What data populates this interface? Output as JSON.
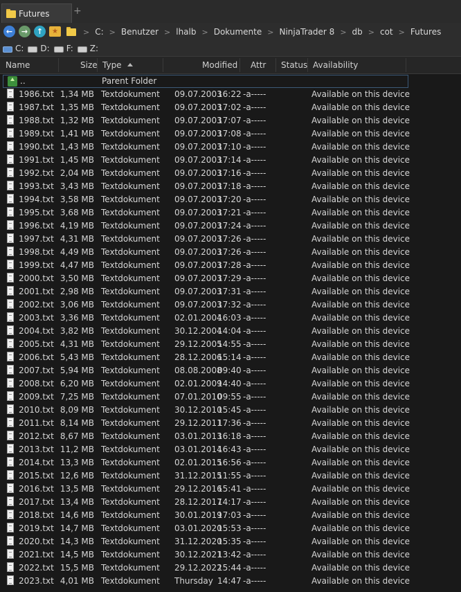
{
  "tab": {
    "title": "Futures",
    "add_label": "+"
  },
  "toolbar": {
    "breadcrumbs": [
      "C:",
      "Benutzer",
      "lhalb",
      "Dokumente",
      "NinjaTrader 8",
      "db",
      "cot",
      "Futures"
    ],
    "separator": ">"
  },
  "drives": [
    {
      "label": "C:",
      "icon": "system-drive-icon"
    },
    {
      "label": "D:",
      "icon": "drive-icon"
    },
    {
      "label": "F:",
      "icon": "drive-icon"
    },
    {
      "label": "Z:",
      "icon": "drive-icon"
    }
  ],
  "columns": {
    "name": "Name",
    "size": "Size",
    "type": "Type",
    "modified": "Modified",
    "attr": "Attr",
    "status": "Status",
    "availability": "Availability"
  },
  "parent": {
    "name": "..",
    "type": "Parent Folder"
  },
  "files": [
    {
      "name": "1986.txt",
      "size": "1,34 MB",
      "type": "Textdokument",
      "date": "09.07.2003",
      "time": "16:22",
      "attr": "-a-----",
      "availability": "Available on this device"
    },
    {
      "name": "1987.txt",
      "size": "1,35 MB",
      "type": "Textdokument",
      "date": "09.07.2003",
      "time": "17:02",
      "attr": "-a-----",
      "availability": "Available on this device"
    },
    {
      "name": "1988.txt",
      "size": "1,32 MB",
      "type": "Textdokument",
      "date": "09.07.2003",
      "time": "17:07",
      "attr": "-a-----",
      "availability": "Available on this device"
    },
    {
      "name": "1989.txt",
      "size": "1,41 MB",
      "type": "Textdokument",
      "date": "09.07.2003",
      "time": "17:08",
      "attr": "-a-----",
      "availability": "Available on this device"
    },
    {
      "name": "1990.txt",
      "size": "1,43 MB",
      "type": "Textdokument",
      "date": "09.07.2003",
      "time": "17:10",
      "attr": "-a-----",
      "availability": "Available on this device"
    },
    {
      "name": "1991.txt",
      "size": "1,45 MB",
      "type": "Textdokument",
      "date": "09.07.2003",
      "time": "17:14",
      "attr": "-a-----",
      "availability": "Available on this device"
    },
    {
      "name": "1992.txt",
      "size": "2,04 MB",
      "type": "Textdokument",
      "date": "09.07.2003",
      "time": "17:16",
      "attr": "-a-----",
      "availability": "Available on this device"
    },
    {
      "name": "1993.txt",
      "size": "3,43 MB",
      "type": "Textdokument",
      "date": "09.07.2003",
      "time": "17:18",
      "attr": "-a-----",
      "availability": "Available on this device"
    },
    {
      "name": "1994.txt",
      "size": "3,58 MB",
      "type": "Textdokument",
      "date": "09.07.2003",
      "time": "17:20",
      "attr": "-a-----",
      "availability": "Available on this device"
    },
    {
      "name": "1995.txt",
      "size": "3,68 MB",
      "type": "Textdokument",
      "date": "09.07.2003",
      "time": "17:21",
      "attr": "-a-----",
      "availability": "Available on this device"
    },
    {
      "name": "1996.txt",
      "size": "4,19 MB",
      "type": "Textdokument",
      "date": "09.07.2003",
      "time": "17:24",
      "attr": "-a-----",
      "availability": "Available on this device"
    },
    {
      "name": "1997.txt",
      "size": "4,31 MB",
      "type": "Textdokument",
      "date": "09.07.2003",
      "time": "17:26",
      "attr": "-a-----",
      "availability": "Available on this device"
    },
    {
      "name": "1998.txt",
      "size": "4,49 MB",
      "type": "Textdokument",
      "date": "09.07.2003",
      "time": "17:26",
      "attr": "-a-----",
      "availability": "Available on this device"
    },
    {
      "name": "1999.txt",
      "size": "4,47 MB",
      "type": "Textdokument",
      "date": "09.07.2003",
      "time": "17:28",
      "attr": "-a-----",
      "availability": "Available on this device"
    },
    {
      "name": "2000.txt",
      "size": "3,50 MB",
      "type": "Textdokument",
      "date": "09.07.2003",
      "time": "17:29",
      "attr": "-a-----",
      "availability": "Available on this device"
    },
    {
      "name": "2001.txt",
      "size": "2,98 MB",
      "type": "Textdokument",
      "date": "09.07.2003",
      "time": "17:31",
      "attr": "-a-----",
      "availability": "Available on this device"
    },
    {
      "name": "2002.txt",
      "size": "3,06 MB",
      "type": "Textdokument",
      "date": "09.07.2003",
      "time": "17:32",
      "attr": "-a-----",
      "availability": "Available on this device"
    },
    {
      "name": "2003.txt",
      "size": "3,36 MB",
      "type": "Textdokument",
      "date": "02.01.2004",
      "time": "16:03",
      "attr": "-a-----",
      "availability": "Available on this device"
    },
    {
      "name": "2004.txt",
      "size": "3,82 MB",
      "type": "Textdokument",
      "date": "30.12.2004",
      "time": "14:04",
      "attr": "-a-----",
      "availability": "Available on this device"
    },
    {
      "name": "2005.txt",
      "size": "4,31 MB",
      "type": "Textdokument",
      "date": "29.12.2005",
      "time": "14:55",
      "attr": "-a-----",
      "availability": "Available on this device"
    },
    {
      "name": "2006.txt",
      "size": "5,43 MB",
      "type": "Textdokument",
      "date": "28.12.2006",
      "time": "15:14",
      "attr": "-a-----",
      "availability": "Available on this device"
    },
    {
      "name": "2007.txt",
      "size": "5,94 MB",
      "type": "Textdokument",
      "date": "08.08.2008",
      "time": "09:40",
      "attr": "-a-----",
      "availability": "Available on this device"
    },
    {
      "name": "2008.txt",
      "size": "6,20 MB",
      "type": "Textdokument",
      "date": "02.01.2009",
      "time": "14:40",
      "attr": "-a-----",
      "availability": "Available on this device"
    },
    {
      "name": "2009.txt",
      "size": "7,25 MB",
      "type": "Textdokument",
      "date": "07.01.2010",
      "time": "09:55",
      "attr": "-a-----",
      "availability": "Available on this device"
    },
    {
      "name": "2010.txt",
      "size": "8,09 MB",
      "type": "Textdokument",
      "date": "30.12.2010",
      "time": "15:45",
      "attr": "-a-----",
      "availability": "Available on this device"
    },
    {
      "name": "2011.txt",
      "size": "8,14 MB",
      "type": "Textdokument",
      "date": "29.12.2011",
      "time": "17:36",
      "attr": "-a-----",
      "availability": "Available on this device"
    },
    {
      "name": "2012.txt",
      "size": "8,67 MB",
      "type": "Textdokument",
      "date": "03.01.2013",
      "time": "16:18",
      "attr": "-a-----",
      "availability": "Available on this device"
    },
    {
      "name": "2013.txt",
      "size": "11,2 MB",
      "type": "Textdokument",
      "date": "03.01.2014",
      "time": "16:43",
      "attr": "-a-----",
      "availability": "Available on this device"
    },
    {
      "name": "2014.txt",
      "size": "13,3 MB",
      "type": "Textdokument",
      "date": "02.01.2015",
      "time": "16:56",
      "attr": "-a-----",
      "availability": "Available on this device"
    },
    {
      "name": "2015.txt",
      "size": "12,6 MB",
      "type": "Textdokument",
      "date": "31.12.2015",
      "time": "11:55",
      "attr": "-a-----",
      "availability": "Available on this device"
    },
    {
      "name": "2016.txt",
      "size": "13,5 MB",
      "type": "Textdokument",
      "date": "29.12.2016",
      "time": "15:41",
      "attr": "-a-----",
      "availability": "Available on this device"
    },
    {
      "name": "2017.txt",
      "size": "13,4 MB",
      "type": "Textdokument",
      "date": "28.12.2017",
      "time": "14:17",
      "attr": "-a-----",
      "availability": "Available on this device"
    },
    {
      "name": "2018.txt",
      "size": "14,6 MB",
      "type": "Textdokument",
      "date": "30.01.2019",
      "time": "17:03",
      "attr": "-a-----",
      "availability": "Available on this device"
    },
    {
      "name": "2019.txt",
      "size": "14,7 MB",
      "type": "Textdokument",
      "date": "03.01.2020",
      "time": "15:53",
      "attr": "-a-----",
      "availability": "Available on this device"
    },
    {
      "name": "2020.txt",
      "size": "14,3 MB",
      "type": "Textdokument",
      "date": "31.12.2020",
      "time": "15:35",
      "attr": "-a-----",
      "availability": "Available on this device"
    },
    {
      "name": "2021.txt",
      "size": "14,5 MB",
      "type": "Textdokument",
      "date": "30.12.2021",
      "time": "13:42",
      "attr": "-a-----",
      "availability": "Available on this device"
    },
    {
      "name": "2022.txt",
      "size": "15,5 MB",
      "type": "Textdokument",
      "date": "29.12.2022",
      "time": "15:44",
      "attr": "-a-----",
      "availability": "Available on this device"
    },
    {
      "name": "2023.txt",
      "size": "4,01 MB",
      "type": "Textdokument",
      "date": "Thursday",
      "time": "14:47",
      "attr": "-a-----",
      "availability": "Available on this device"
    }
  ]
}
